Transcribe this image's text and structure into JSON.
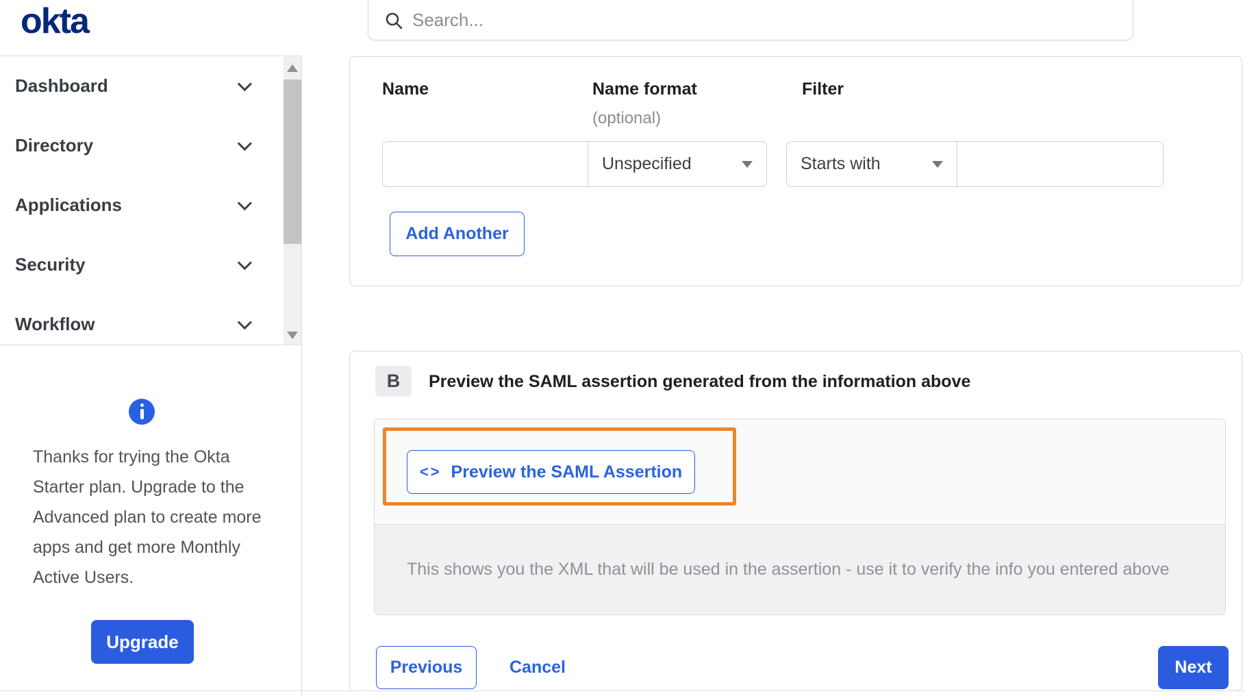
{
  "header": {
    "logo_text": "okta",
    "search": {
      "placeholder": "Search..."
    }
  },
  "sidebar": {
    "items": [
      {
        "label": "Dashboard"
      },
      {
        "label": "Directory"
      },
      {
        "label": "Applications"
      },
      {
        "label": "Security"
      },
      {
        "label": "Workflow"
      }
    ],
    "promo": {
      "message": "Thanks for trying the Okta Starter plan. Upgrade to the Advanced plan to create more apps and get more Monthly Active Users.",
      "upgrade_label": "Upgrade"
    }
  },
  "attribute_form": {
    "columns": {
      "name": "Name",
      "name_format": "Name format",
      "name_format_note": "(optional)",
      "filter": "Filter"
    },
    "name_value": "",
    "name_format_selected": "Unspecified",
    "filter_op_selected": "Starts with",
    "filter_value": "",
    "add_another_label": "Add Another"
  },
  "preview_section": {
    "badge": "B",
    "title": "Preview the SAML assertion generated from the information above",
    "preview_button_icon": "<>",
    "preview_button_label": "Preview the SAML Assertion",
    "description": "This shows you the XML that will be used in the assertion - use it to verify the info you entered above"
  },
  "footer": {
    "previous_label": "Previous",
    "cancel_label": "Cancel",
    "next_label": "Next"
  },
  "colors": {
    "accent_blue": "#2b5ce0",
    "brand_navy": "#00297a",
    "highlight_orange": "#e8872e"
  }
}
